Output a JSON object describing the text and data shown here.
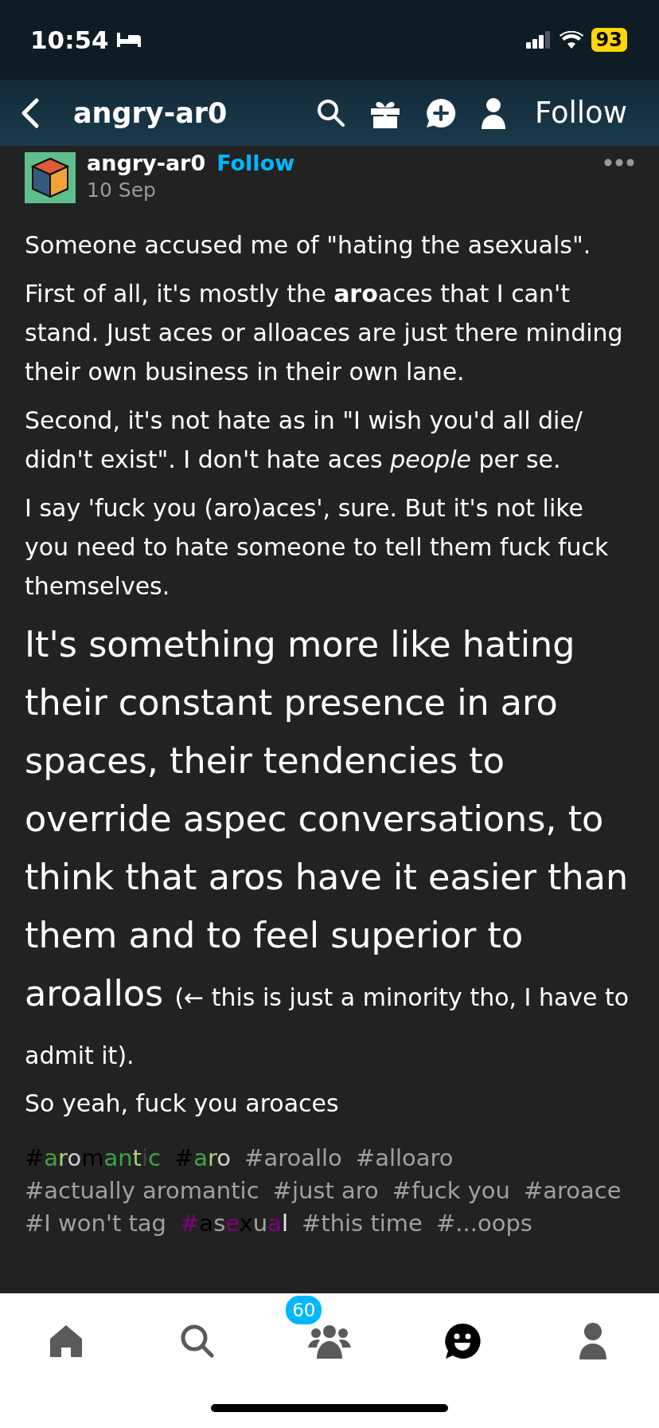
{
  "status_bar": {
    "time": "10:54",
    "battery": "93"
  },
  "nav_bar": {
    "title": "angry-ar0",
    "follow": "Follow"
  },
  "post": {
    "author": "angry-ar0",
    "follow": "Follow",
    "date": "10 Sep",
    "paragraphs": [
      {
        "kind": "normal",
        "text": "Someone accused me of \"hating the asexuals\"."
      },
      {
        "kind": "normal",
        "text": "First of all, it's mostly the **aro**aces that I can't stand. Just aces or alloaces are just there minding their own business in their own lane."
      },
      {
        "kind": "normal",
        "text": "Second, it's not hate as in \"I wish you'd all die/ didn't exist\". I don't hate aces *people* per se."
      },
      {
        "kind": "normal",
        "text": "I say 'fuck you (aro)aces', sure. But it's not like you need to hate someone to tell them fuck fuck themselves."
      },
      {
        "kind": "big",
        "text": "It's something more like hating their constant presence in aro spaces, their tendencies to override aspec conversations, to think that aros have it easier than them and to feel superior to aroallos",
        "tail": "(← this is just a minority tho, I have to admit it)."
      },
      {
        "kind": "normal",
        "text": "So yeah, fuck you aroaces"
      }
    ],
    "tags": [
      {
        "parts": [
          {
            "text": "#",
            "color": "#000000"
          },
          {
            "text": "a",
            "color": "#3da542"
          },
          {
            "text": "r",
            "color": "#a7d379"
          },
          {
            "text": "o",
            "color": "#d0d0d0"
          },
          {
            "text": "m",
            "color": "#000000"
          },
          {
            "text": "a",
            "color": "#3da542"
          },
          {
            "text": "n",
            "color": "#3da542"
          },
          {
            "text": "t",
            "color": "#a7d379"
          },
          {
            "text": "i",
            "color": "#444444"
          },
          {
            "text": "c",
            "color": "#3da542"
          }
        ]
      },
      {
        "parts": [
          {
            "text": "#",
            "color": "#000000"
          },
          {
            "text": "a",
            "color": "#3da542"
          },
          {
            "text": "r",
            "color": "#a7d379"
          },
          {
            "text": "o",
            "color": "#d0d0d0"
          }
        ]
      },
      {
        "parts": [
          {
            "text": "#aroallo",
            "color": "#a0a0a0"
          }
        ]
      },
      {
        "parts": [
          {
            "text": "#alloaro",
            "color": "#a0a0a0"
          }
        ]
      },
      {
        "parts": [
          {
            "text": "#actually aromantic",
            "color": "#a0a0a0"
          }
        ]
      },
      {
        "parts": [
          {
            "text": "#just aro",
            "color": "#a0a0a0"
          }
        ]
      },
      {
        "parts": [
          {
            "text": "#fuck you",
            "color": "#a0a0a0"
          }
        ]
      },
      {
        "parts": [
          {
            "text": "#aroace",
            "color": "#a0a0a0"
          }
        ]
      },
      {
        "parts": [
          {
            "text": "#I won't tag",
            "color": "#a0a0a0"
          }
        ]
      },
      {
        "parts": [
          {
            "text": "#",
            "color": "#800080"
          },
          {
            "text": "a",
            "color": "#000000"
          },
          {
            "text": "s",
            "color": "#a3a3a3"
          },
          {
            "text": "e",
            "color": "#800080"
          },
          {
            "text": "x",
            "color": "#000000"
          },
          {
            "text": "u",
            "color": "#a3a3a3"
          },
          {
            "text": "a",
            "color": "#800080"
          },
          {
            "text": "l",
            "color": "#e8e8e8"
          }
        ]
      },
      {
        "parts": [
          {
            "text": "#this time",
            "color": "#a0a0a0"
          }
        ]
      },
      {
        "parts": [
          {
            "text": "#...oops",
            "color": "#a0a0a0"
          }
        ]
      }
    ]
  },
  "tab_bar": [
    {
      "kind": "home",
      "selected": false
    },
    {
      "kind": "search",
      "selected": false
    },
    {
      "kind": "community",
      "selected": false,
      "badge": "60"
    },
    {
      "kind": "chat",
      "selected": true
    },
    {
      "kind": "account",
      "selected": false
    }
  ]
}
